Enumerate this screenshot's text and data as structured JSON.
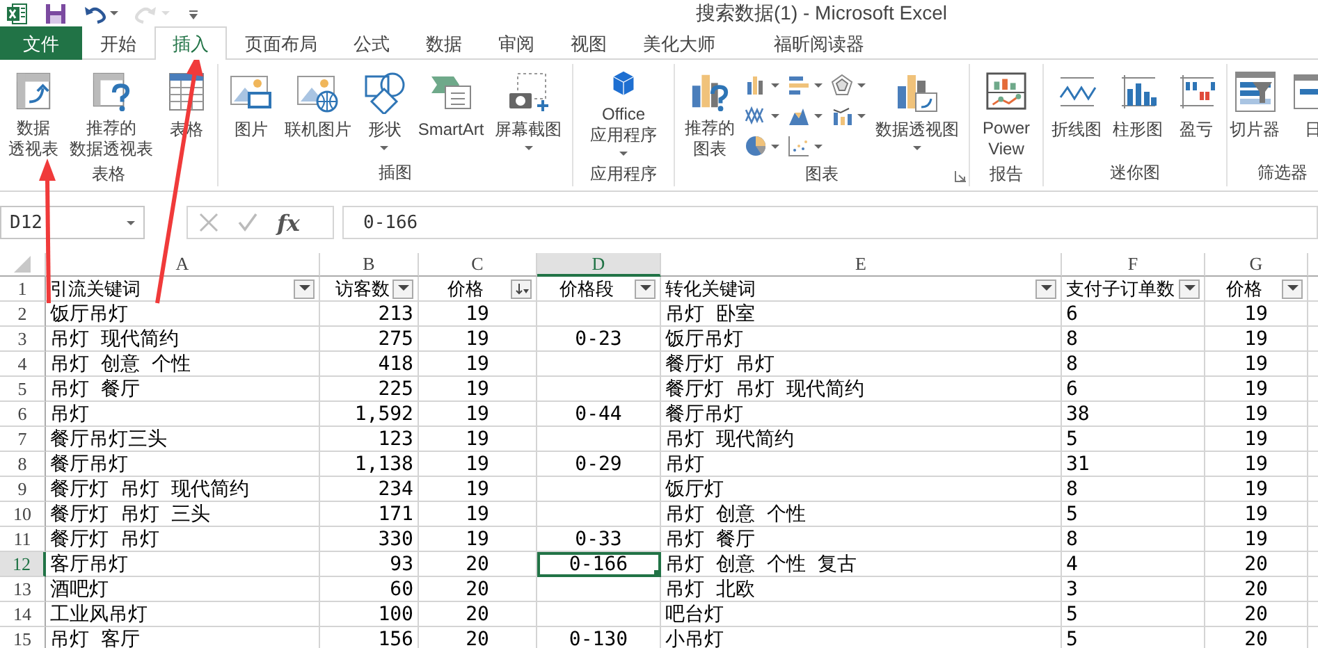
{
  "window": {
    "title": "搜索数据(1) - Microsoft Excel"
  },
  "quick_access": [
    {
      "kind": "logo",
      "disabled": false,
      "dropdown": false
    },
    {
      "kind": "save",
      "disabled": false,
      "dropdown": false
    },
    {
      "kind": "undo",
      "disabled": false,
      "dropdown": true
    },
    {
      "kind": "redo",
      "disabled": true,
      "dropdown": true
    },
    {
      "kind": "customize",
      "disabled": false,
      "dropdown": false
    }
  ],
  "tabs": [
    {
      "label": "文件",
      "kind": "file",
      "selected": false
    },
    {
      "label": "开始",
      "kind": "tab",
      "selected": false
    },
    {
      "label": "插入",
      "kind": "tab",
      "selected": true
    },
    {
      "label": "页面布局",
      "kind": "tab",
      "selected": false
    },
    {
      "label": "公式",
      "kind": "tab",
      "selected": false
    },
    {
      "label": "数据",
      "kind": "tab",
      "selected": false
    },
    {
      "label": "审阅",
      "kind": "tab",
      "selected": false
    },
    {
      "label": "视图",
      "kind": "tab",
      "selected": false
    },
    {
      "label": "美化大师",
      "kind": "tab",
      "selected": false
    },
    {
      "label": "福昕阅读器",
      "kind": "tab",
      "selected": false
    }
  ],
  "ribbon": {
    "groups": [
      {
        "label": "表格",
        "launcher": false,
        "buttons": [
          {
            "kind": "large",
            "lines": [
              "数据",
              "透视表"
            ],
            "dropdown": false
          },
          {
            "kind": "large",
            "lines": [
              "推荐的",
              "数据透视表"
            ],
            "dropdown": false
          },
          {
            "kind": "large",
            "lines": [
              "表格"
            ],
            "dropdown": false
          }
        ]
      },
      {
        "label": "插图",
        "launcher": false,
        "buttons": [
          {
            "kind": "large",
            "lines": [
              "图片"
            ],
            "dropdown": false
          },
          {
            "kind": "large",
            "lines": [
              "联机图片"
            ],
            "dropdown": false
          },
          {
            "kind": "large",
            "lines": [
              "形状"
            ],
            "dropdown": true
          },
          {
            "kind": "large",
            "lines": [
              "SmartArt"
            ],
            "dropdown": false
          },
          {
            "kind": "large",
            "lines": [
              "屏幕截图"
            ],
            "dropdown": true
          }
        ]
      },
      {
        "label": "应用程序",
        "launcher": false,
        "buttons": [
          {
            "kind": "large",
            "lines": [
              "Office",
              "应用程序"
            ],
            "dropdown": true
          }
        ]
      },
      {
        "label": "图表",
        "launcher": true,
        "buttons": [
          {
            "kind": "large",
            "lines": [
              "推荐的",
              "图表"
            ],
            "dropdown": false
          },
          {
            "kind": "small",
            "dropdown": true
          },
          {
            "kind": "small",
            "dropdown": true
          },
          {
            "kind": "small",
            "dropdown": true
          },
          {
            "kind": "small",
            "dropdown": true
          },
          {
            "kind": "small",
            "dropdown": true
          },
          {
            "kind": "small",
            "dropdown": true
          },
          {
            "kind": "small",
            "dropdown": true
          },
          {
            "kind": "small",
            "dropdown": true
          },
          {
            "kind": "large",
            "lines": [
              "数据透视图"
            ],
            "dropdown": true
          }
        ]
      },
      {
        "label": "报告",
        "launcher": false,
        "buttons": [
          {
            "kind": "large",
            "lines": [
              "Power",
              "View"
            ],
            "dropdown": false
          }
        ]
      },
      {
        "label": "迷你图",
        "launcher": false,
        "buttons": [
          {
            "kind": "large",
            "lines": [
              "折线图"
            ],
            "dropdown": false
          },
          {
            "kind": "large",
            "lines": [
              "柱形图"
            ],
            "dropdown": false
          },
          {
            "kind": "large",
            "lines": [
              "盈亏"
            ],
            "dropdown": false
          }
        ]
      },
      {
        "label": "筛选器",
        "launcher": false,
        "buttons": [
          {
            "kind": "large",
            "lines": [
              "切片器"
            ],
            "dropdown": false
          },
          {
            "kind": "large",
            "lines": [
              "日"
            ],
            "dropdown": false
          }
        ]
      }
    ]
  },
  "formula_bar": {
    "name_box": "D12",
    "function_label": "fx",
    "formula": "0-166"
  },
  "table": {
    "header_row": {
      "number": "1",
      "selected": false
    },
    "columns": [
      {
        "letter": "A",
        "header": "引流关键词",
        "sorted": false,
        "selected": false
      },
      {
        "letter": "B",
        "header": "访客数",
        "sorted": false,
        "selected": false
      },
      {
        "letter": "C",
        "header": "价格",
        "sorted": true,
        "selected": false
      },
      {
        "letter": "D",
        "header": "价格段",
        "sorted": false,
        "selected": true
      },
      {
        "letter": "E",
        "header": "转化关键词",
        "sorted": false,
        "selected": false
      },
      {
        "letter": "F",
        "header": "支付子订单数",
        "sorted": false,
        "selected": false
      },
      {
        "letter": "G",
        "header": "价格",
        "sorted": false,
        "selected": false
      }
    ],
    "rows": [
      {
        "number": "2",
        "selected": false,
        "cells": [
          "饭厅吊灯",
          "213",
          "19",
          null,
          "吊灯 卧室",
          "6",
          "19"
        ]
      },
      {
        "number": "3",
        "selected": false,
        "cells": [
          "吊灯 现代简约",
          "275",
          "19",
          "0-23",
          "饭厅吊灯",
          "8",
          "19"
        ]
      },
      {
        "number": "4",
        "selected": false,
        "cells": [
          "吊灯 创意 个性",
          "418",
          "19",
          null,
          "餐厅灯 吊灯",
          "8",
          "19"
        ]
      },
      {
        "number": "5",
        "selected": false,
        "cells": [
          "吊灯 餐厅",
          "225",
          "19",
          null,
          "餐厅灯 吊灯 现代简约",
          "6",
          "19"
        ]
      },
      {
        "number": "6",
        "selected": false,
        "cells": [
          "吊灯",
          "1,592",
          "19",
          "0-44",
          "餐厅吊灯",
          "38",
          "19"
        ]
      },
      {
        "number": "7",
        "selected": false,
        "cells": [
          "餐厅吊灯三头",
          "123",
          "19",
          null,
          "吊灯 现代简约",
          "5",
          "19"
        ]
      },
      {
        "number": "8",
        "selected": false,
        "cells": [
          "餐厅吊灯",
          "1,138",
          "19",
          "0-29",
          "吊灯",
          "31",
          "19"
        ]
      },
      {
        "number": "9",
        "selected": false,
        "cells": [
          "餐厅灯 吊灯 现代简约",
          "234",
          "19",
          null,
          "饭厅灯",
          "8",
          "19"
        ]
      },
      {
        "number": "10",
        "selected": false,
        "cells": [
          "餐厅灯 吊灯 三头",
          "171",
          "19",
          null,
          "吊灯 创意 个性",
          "5",
          "19"
        ]
      },
      {
        "number": "11",
        "selected": false,
        "cells": [
          "餐厅灯 吊灯",
          "330",
          "19",
          "0-33",
          "吊灯 餐厅",
          "8",
          "19"
        ]
      },
      {
        "number": "12",
        "selected": true,
        "cells": [
          "客厅吊灯",
          "93",
          "20",
          "0-166",
          "吊灯 创意 个性 复古",
          "4",
          "20"
        ]
      },
      {
        "number": "13",
        "selected": false,
        "cells": [
          "酒吧灯",
          "60",
          "20",
          null,
          "吊灯 北欧",
          "3",
          "20"
        ]
      },
      {
        "number": "14",
        "selected": false,
        "cells": [
          "工业风吊灯",
          "100",
          "20",
          null,
          "吧台灯",
          "5",
          "20"
        ]
      },
      {
        "number": "15",
        "selected": false,
        "cells": [
          "吊灯 客厅",
          "156",
          "20",
          "0-130",
          "小吊灯",
          "5",
          "20"
        ]
      }
    ]
  }
}
